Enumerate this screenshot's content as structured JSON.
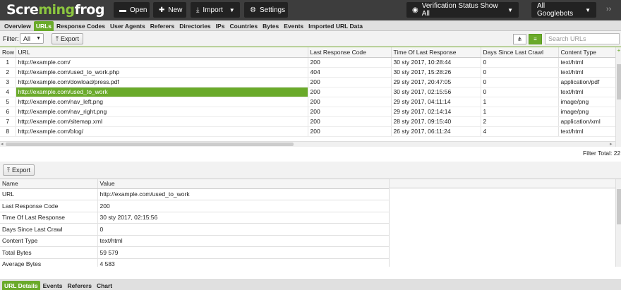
{
  "app": {
    "logo_left": "Scre",
    "logo_frog": "ming",
    "logo_right": "frog"
  },
  "toolbar": {
    "open": "Open",
    "new": "New",
    "import": "Import",
    "settings": "Settings",
    "verification": "Verification Status Show All",
    "googlebots": "All Googlebots",
    "more": "››"
  },
  "icons": {
    "open": "folder-icon",
    "new": "plus-icon",
    "import": "download-icon",
    "settings": "gear-icon",
    "verification": "eye-icon",
    "export": "upload-icon",
    "tree_view": "tree-icon",
    "list_view": "list-icon"
  },
  "tabs": [
    "Overview",
    "URLs",
    "Response Codes",
    "User Agents",
    "Referers",
    "Directories",
    "IPs",
    "Countries",
    "Bytes",
    "Events",
    "Imported URL Data"
  ],
  "active_tab": "URLs",
  "filter": {
    "label": "Filter:",
    "value": "All",
    "export": "Export",
    "search_placeholder": "Search URLs"
  },
  "grid": {
    "columns": [
      "Row",
      "URL",
      "Last Response Code",
      "Time Of Last Response",
      "Days Since Last Crawl",
      "Content Type"
    ],
    "rows": [
      [
        "1",
        "http://example.com/",
        "200",
        "30 sty 2017, 10:28:44",
        "0",
        "text/html"
      ],
      [
        "2",
        "http://example.com/used_to_work.php",
        "404",
        "30 sty 2017, 15:28:26",
        "0",
        "text/html"
      ],
      [
        "3",
        "http://example.com/dowload/press.pdf",
        "200",
        "29 sty 2017, 20:47:05",
        "0",
        "application/pdf"
      ],
      [
        "4",
        "http://example.com/used_to_work",
        "200",
        "30 sty 2017, 02:15:56",
        "0",
        "text/html"
      ],
      [
        "5",
        "http://example.com/nav_left.png",
        "200",
        "29 sty 2017, 04:11:14",
        "1",
        "image/png"
      ],
      [
        "6",
        "http://example.com/nav_right.png",
        "200",
        "29 sty 2017, 02:14:14",
        "1",
        "image/png"
      ],
      [
        "7",
        "http://example.com/sitemap.xml",
        "200",
        "28 sty 2017, 09:15:40",
        "2",
        "application/xml"
      ],
      [
        "8",
        "http://example.com/blog/",
        "200",
        "26 sty 2017, 06:11:24",
        "4",
        "text/html"
      ]
    ],
    "selected_row": 3,
    "filter_total": "Filter Total: 22"
  },
  "detail": {
    "export": "Export",
    "columns": [
      "Name",
      "Value"
    ],
    "rows": [
      [
        "URL",
        "http://example.com/used_to_work"
      ],
      [
        "Last Response Code",
        "200"
      ],
      [
        "Time Of Last Response",
        "30 sty 2017, 02:15:56"
      ],
      [
        "Days Since Last Crawl",
        "0"
      ],
      [
        "Content Type",
        "text/html"
      ],
      [
        "Total Bytes",
        "59 579"
      ],
      [
        "Average Bytes",
        "4 583"
      ]
    ]
  },
  "bottom_tabs": [
    "URL Details",
    "Events",
    "Referers",
    "Chart"
  ],
  "active_bottom_tab": "URL Details",
  "colors": {
    "accent": "#6aaa2a",
    "header_bg": "#3d3d3d"
  }
}
